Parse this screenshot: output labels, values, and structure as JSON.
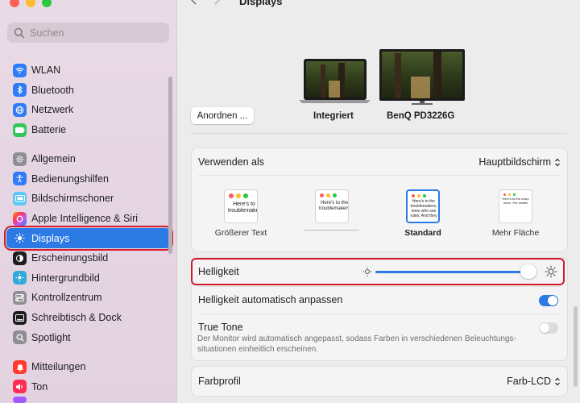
{
  "window": {
    "title": "Displays"
  },
  "search": {
    "placeholder": "Suchen"
  },
  "sidebar": {
    "items": [
      {
        "label": "WLAN",
        "icon": "wifi-icon",
        "color": "#2f7cf6"
      },
      {
        "label": "Bluetooth",
        "icon": "bluetooth-icon",
        "color": "#2f7cf6"
      },
      {
        "label": "Netzwerk",
        "icon": "globe-icon",
        "color": "#2f7cf6"
      },
      {
        "label": "Batterie",
        "icon": "battery-icon",
        "color": "#34c759"
      },
      {
        "label": "Allgemein",
        "icon": "gear-icon",
        "color": "#8e8e93"
      },
      {
        "label": "Bedienungshilfen",
        "icon": "accessibility-icon",
        "color": "#2f7cf6"
      },
      {
        "label": "Bildschirmschoner",
        "icon": "screensaver-icon",
        "color": "#5ac8fa"
      },
      {
        "label": "Apple Intelligence & Siri",
        "icon": "siri-icon",
        "color": "#ff6f91"
      },
      {
        "label": "Displays",
        "icon": "sun-icon",
        "color": "#2f7cf6"
      },
      {
        "label": "Erscheinungsbild",
        "icon": "appearance-icon",
        "color": "#1d1d1f"
      },
      {
        "label": "Hintergrundbild",
        "icon": "wallpaper-icon",
        "color": "#34aadc"
      },
      {
        "label": "Kontrollzentrum",
        "icon": "control-center-icon",
        "color": "#8e8e93"
      },
      {
        "label": "Schreibtisch & Dock",
        "icon": "dock-icon",
        "color": "#1d1d1f"
      },
      {
        "label": "Spotlight",
        "icon": "search-icon",
        "color": "#8e8e93"
      },
      {
        "label": "Mitteilungen",
        "icon": "bell-icon",
        "color": "#ff3b30"
      },
      {
        "label": "Ton",
        "icon": "speaker-icon",
        "color": "#ff2d55"
      }
    ],
    "active_item": "Displays"
  },
  "displays": {
    "arrange_button": "Anordnen ...",
    "builtin_label": "Integriert",
    "external_label": "BenQ PD3226G"
  },
  "settings": {
    "use_as_label": "Verwenden als",
    "use_as_value": "Hauptbildschirm",
    "resolution_options": [
      {
        "label": "Größerer Text",
        "preview": "Here's to troublemaker"
      },
      {
        "label": "",
        "preview": "Here's to the troublemakers"
      },
      {
        "label": "Standard",
        "preview": "Here's to the troublemakers, ones who see rules. And they"
      },
      {
        "label": "Mehr Fläche",
        "preview": "Here's to the crazy ones. The misfits"
      }
    ],
    "selected_resolution": "Standard",
    "brightness_label": "Helligkeit",
    "brightness_value": 0.97,
    "auto_brightness_label": "Helligkeit automatisch anpassen",
    "auto_brightness_on": true,
    "true_tone_label": "True Tone",
    "true_tone_desc": "Der Monitor wird automatisch angepasst, sodass Farben in verschiedenen Beleuchtungs-situationen einheitlich erscheinen.",
    "true_tone_on": false,
    "color_profile_label": "Farbprofil",
    "color_profile_value": "Farb-LCD"
  },
  "colors": {
    "accent": "#2c7be5",
    "highlight_frame": "#d11a2a"
  }
}
